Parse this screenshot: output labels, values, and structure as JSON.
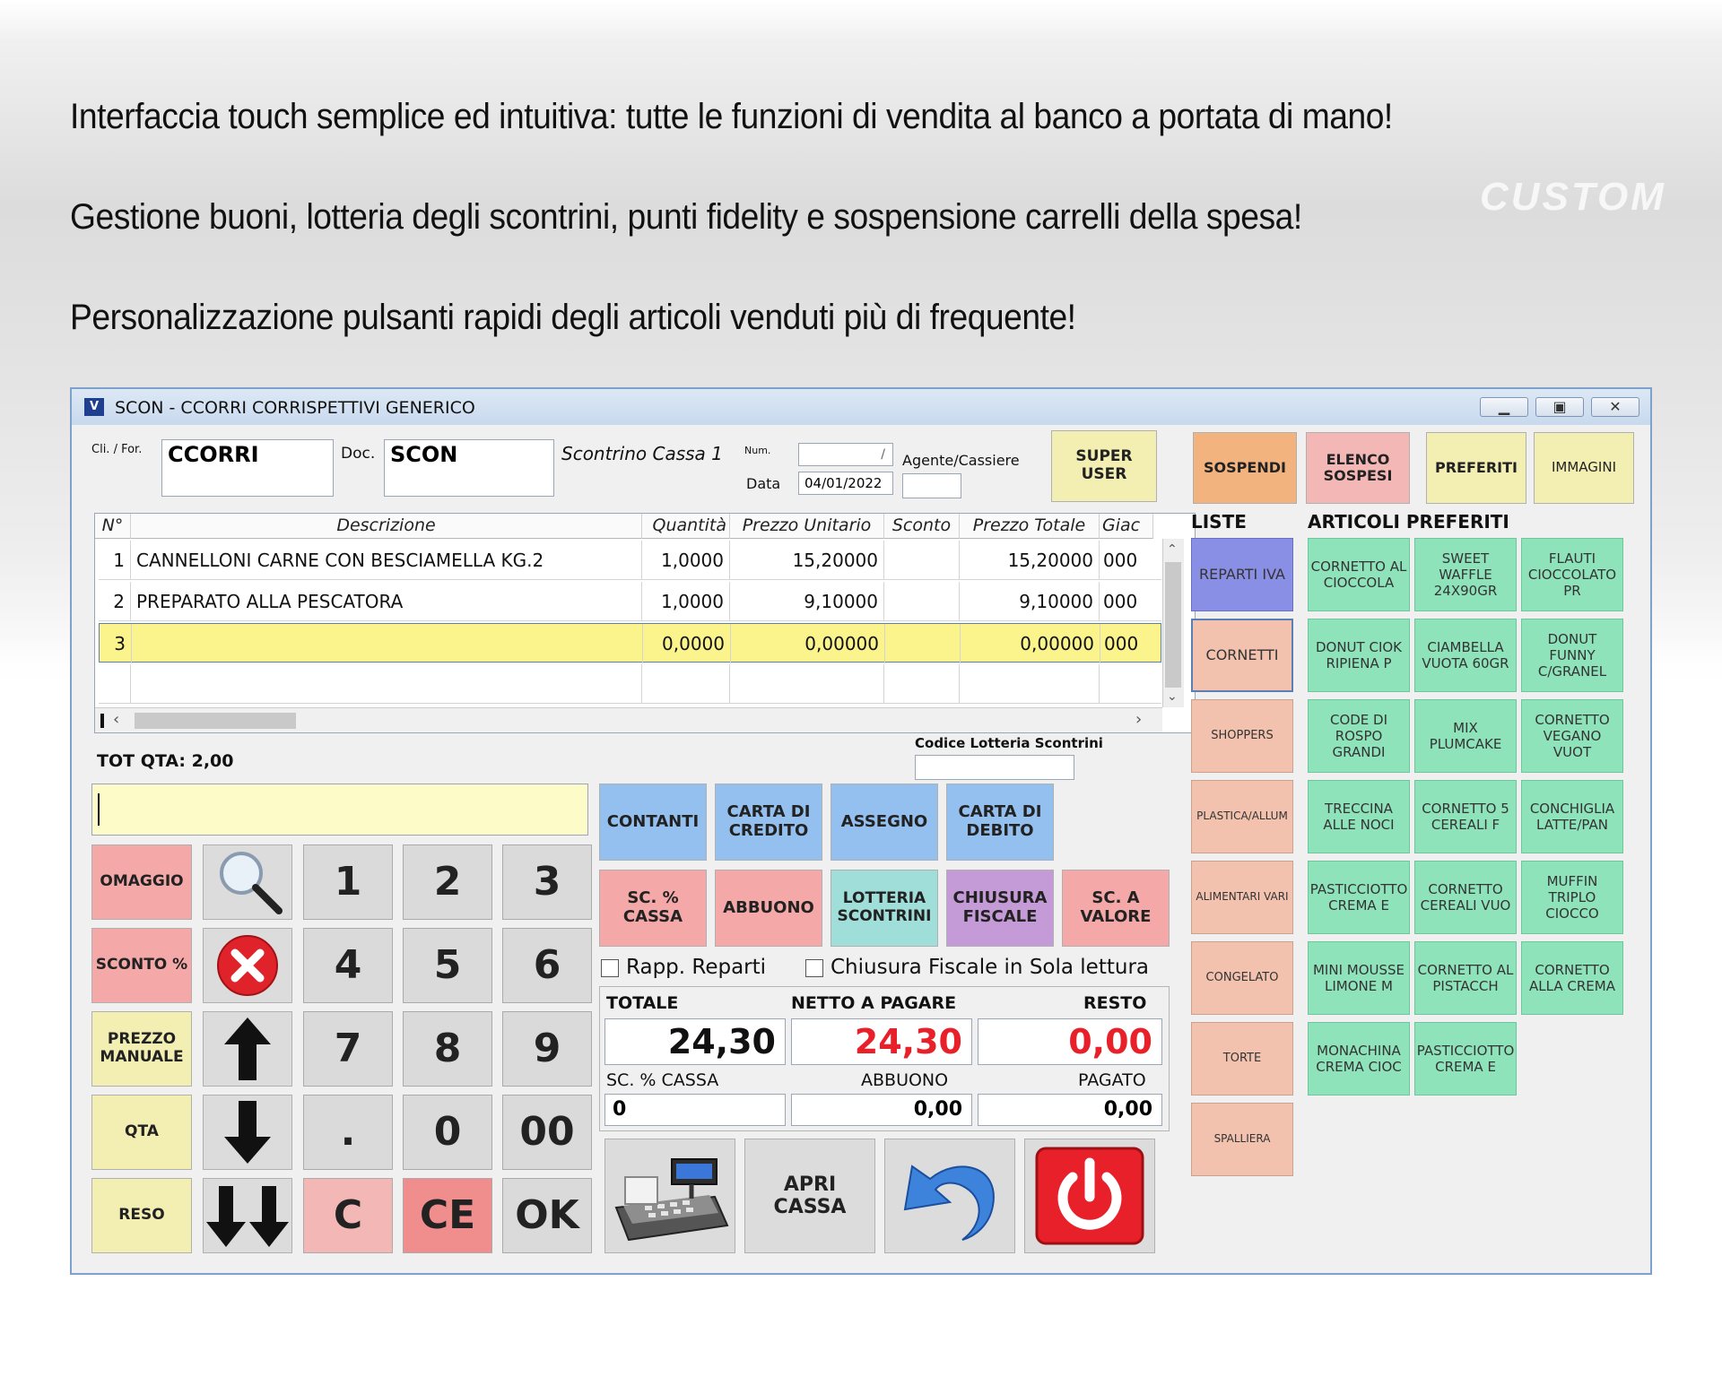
{
  "headlines": [
    "Interfaccia touch semplice ed intuitiva: tutte le funzioni di vendita al banco a portata di mano!",
    "Gestione buoni, lotteria degli scontrini, punti fidelity e sospensione carrelli della spesa!",
    "Personalizzazione pulsanti rapidi degli articoli venduti più di frequente!"
  ],
  "watermark": "CUSTOM",
  "window": {
    "title": "SCON  - CCORRI CORRISPETTIVI GENERICO",
    "icon": "app-icon"
  },
  "header": {
    "cli_label": "Cli. / For.",
    "cli_value": "CCORRI",
    "doc_label": "Doc.",
    "doc_value": "SCON",
    "register_label": "Scontrino Cassa 1",
    "num_label": "Num.",
    "num_value": "/",
    "data_label": "Data",
    "data_value": "04/01/2022",
    "agent_label": "Agente/Cassiere",
    "agent_value": "",
    "super_user": "SUPER USER"
  },
  "grid": {
    "headers": [
      "N°",
      "Descrizione",
      "Quantità",
      "Prezzo Unitario",
      "Sconto",
      "Prezzo Totale",
      "Giac"
    ],
    "rows": [
      {
        "n": "1",
        "desc": "CANNELLONI CARNE CON BESCIAMELLA KG.2",
        "qty": "1,0000",
        "price": "15,20000",
        "disc": "",
        "total": "15,20000",
        "giac": "000"
      },
      {
        "n": "2",
        "desc": "PREPARATO ALLA PESCATORA",
        "qty": "1,0000",
        "price": "9,10000",
        "disc": "",
        "total": "9,10000",
        "giac": "000"
      },
      {
        "n": "3",
        "desc": "",
        "qty": "0,0000",
        "price": "0,00000",
        "disc": "",
        "total": "0,00000",
        "giac": "000"
      }
    ]
  },
  "lottery_label": "Codice Lotteria Scontrini",
  "tot_qta": "TOT QTA: 2,00",
  "left_buttons": [
    "OMAGGIO",
    "SCONTO %",
    "PREZZO MANUALE",
    "QTA",
    "RESO"
  ],
  "keypad": [
    "1",
    "2",
    "3",
    "4",
    "5",
    "6",
    "7",
    "8",
    "9",
    ".",
    "0",
    "00",
    "C",
    "CE",
    "OK"
  ],
  "payment_buttons": [
    "CONTANTI",
    "CARTA DI CREDITO",
    "ASSEGNO",
    "CARTA DI DEBITO"
  ],
  "action_buttons": [
    "SC. % CASSA",
    "ABBUONO",
    "LOTTERIA SCONTRINI",
    "CHIUSURA FISCALE",
    "SC. A VALORE"
  ],
  "checkboxes": [
    "Rapp. Reparti",
    "Chiusura Fiscale in Sola lettura"
  ],
  "totals": {
    "totale_label": "TOTALE",
    "netto_label": "NETTO A PAGARE",
    "resto_label": "RESTO",
    "totale": "24,30",
    "netto": "24,30",
    "resto": "0,00",
    "sc_cassa_label": "SC. % CASSA",
    "abbuono_label": "ABBUONO",
    "pagato_label": "PAGATO",
    "sc_cassa": "0",
    "abbuono": "0,00",
    "pagato": "0,00"
  },
  "bottom_buttons": {
    "apri_cassa": "APRI CASSA"
  },
  "top_right_buttons": [
    "SOSPENDI",
    "ELENCO SOSPESI",
    "PREFERITI",
    "IMMAGINI"
  ],
  "liste_label": "LISTE",
  "preferiti_label": "ARTICOLI PREFERITI",
  "liste": [
    "REPARTI IVA",
    "CORNETTI",
    "SHOPPERS",
    "PLASTICA/ALLUM",
    "ALIMENTARI VARI",
    "CONGELATO",
    "TORTE",
    "SPALLIERA"
  ],
  "favorites": [
    "CORNETTO AL CIOCCOLA",
    "SWEET WAFFLE 24X90GR",
    "FLAUTI CIOCCOLATO PR",
    "DONUT CIOK RIPIENA P",
    "CIAMBELLA VUOTA 60GR",
    "DONUT FUNNY C/GRANEL",
    "CODE DI ROSPO GRANDI",
    "MIX PLUMCAKE",
    "CORNETTO VEGANO VUOT",
    "TRECCINA ALLE NOCI",
    "CORNETTO 5 CEREALI F",
    "CONCHIGLIA LATTE/PAN",
    "PASTICCIOTTO CREMA E",
    "CORNETTO CEREALI VUO",
    "MUFFIN TRIPLO CIOCCO",
    "MINI MOUSSE LIMONE M",
    "CORNETTO AL PISTACCH",
    "CORNETTO ALLA CREMA",
    "MONACHINA CREMA CIOC",
    "PASTICCIOTTO CREMA E"
  ],
  "colors": {
    "accent_red": "#e8202a",
    "row_highlight": "#fbf48c",
    "ok_green": "#7fe79b"
  }
}
